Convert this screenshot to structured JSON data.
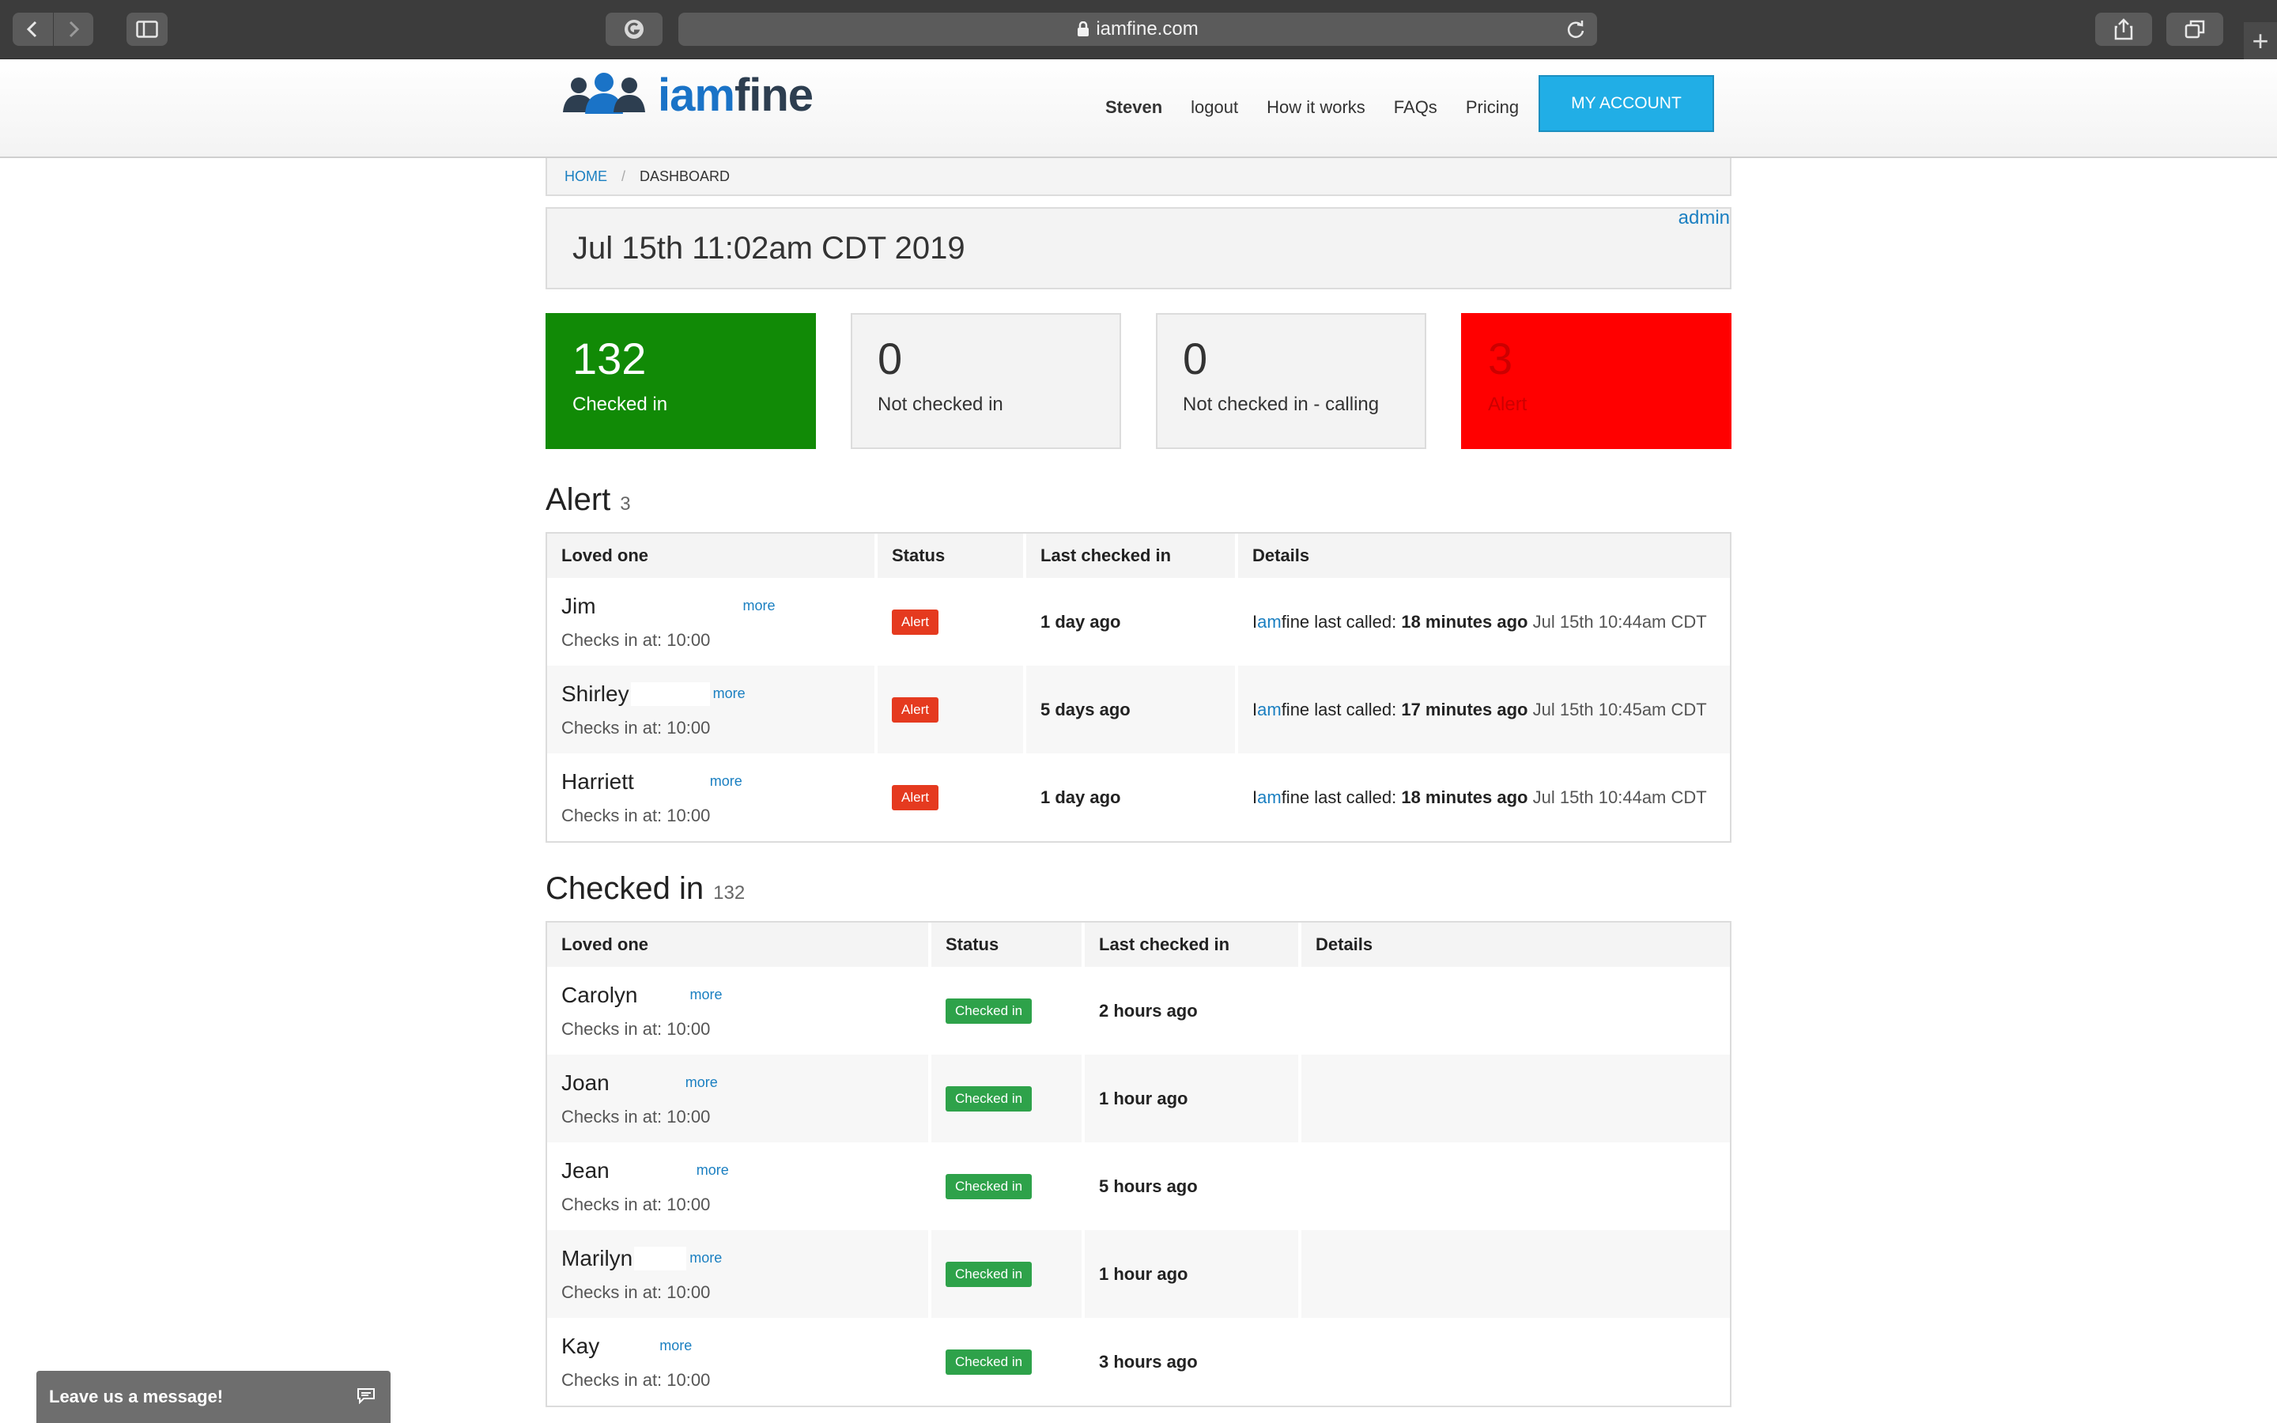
{
  "browser": {
    "url": "iamfine.com"
  },
  "header": {
    "logo_text_prefix": "iam",
    "logo_text_suffix": "fine",
    "nav": [
      "Steven",
      "logout",
      "How it works",
      "FAQs",
      "Pricing"
    ],
    "my_account": "MY ACCOUNT"
  },
  "breadcrumb": {
    "home": "HOME",
    "separator": "/",
    "current": "DASHBOARD"
  },
  "date_panel": {
    "date": "Jul 15th 11:02am CDT 2019",
    "admin": "admin"
  },
  "stats": [
    {
      "value": "132",
      "label": "Checked in",
      "color": "#118a06"
    },
    {
      "value": "0",
      "label": "Not checked in"
    },
    {
      "value": "0",
      "label": "Not checked in - calling"
    },
    {
      "value": "3",
      "label": "Alert",
      "color": "#ff0000"
    }
  ],
  "alert_section": {
    "title": "Alert",
    "count": "3",
    "headers": [
      "Loved one",
      "Status",
      "Last checked in",
      "Details"
    ],
    "rows": [
      {
        "name": "Jim",
        "more": "more",
        "checks": "Checks in at: 10:00",
        "status": "Alert",
        "last": "1 day ago",
        "detail_prefix": "I",
        "detail_brand": "am",
        "detail_rest": "fine last called: ",
        "detail_ago": "18 minutes ago",
        "detail_ts": " Jul 15th 10:44am CDT"
      },
      {
        "name": "Shirley",
        "more": "more",
        "checks": "Checks in at: 10:00",
        "status": "Alert",
        "last": "5 days ago",
        "detail_prefix": "I",
        "detail_brand": "am",
        "detail_rest": "fine last called: ",
        "detail_ago": "17 minutes ago",
        "detail_ts": " Jul 15th 10:45am CDT"
      },
      {
        "name": "Harriett",
        "more": "more",
        "checks": "Checks in at: 10:00",
        "status": "Alert",
        "last": "1 day ago",
        "detail_prefix": "I",
        "detail_brand": "am",
        "detail_rest": "fine last called: ",
        "detail_ago": "18 minutes ago",
        "detail_ts": " Jul 15th 10:44am CDT"
      }
    ]
  },
  "checked_section": {
    "title": "Checked in",
    "count": "132",
    "headers": [
      "Loved one",
      "Status",
      "Last checked in",
      "Details"
    ],
    "rows": [
      {
        "name": "Carolyn",
        "more": "more",
        "checks": "Checks in at: 10:00",
        "status": "Checked in",
        "last": "2 hours ago"
      },
      {
        "name": "Joan",
        "more": "more",
        "checks": "Checks in at: 10:00",
        "status": "Checked in",
        "last": "1 hour ago"
      },
      {
        "name": "Jean",
        "more": "more",
        "checks": "Checks in at: 10:00",
        "status": "Checked in",
        "last": "5 hours ago"
      },
      {
        "name": "Marilyn",
        "more": "more",
        "checks": "Checks in at: 10:00",
        "status": "Checked in",
        "last": "1 hour ago"
      },
      {
        "name": "Kay",
        "more": "more",
        "checks": "Checks in at: 10:00",
        "status": "Checked in",
        "last": "3 hours ago"
      }
    ]
  },
  "chat": {
    "label": "Leave us a message!"
  }
}
